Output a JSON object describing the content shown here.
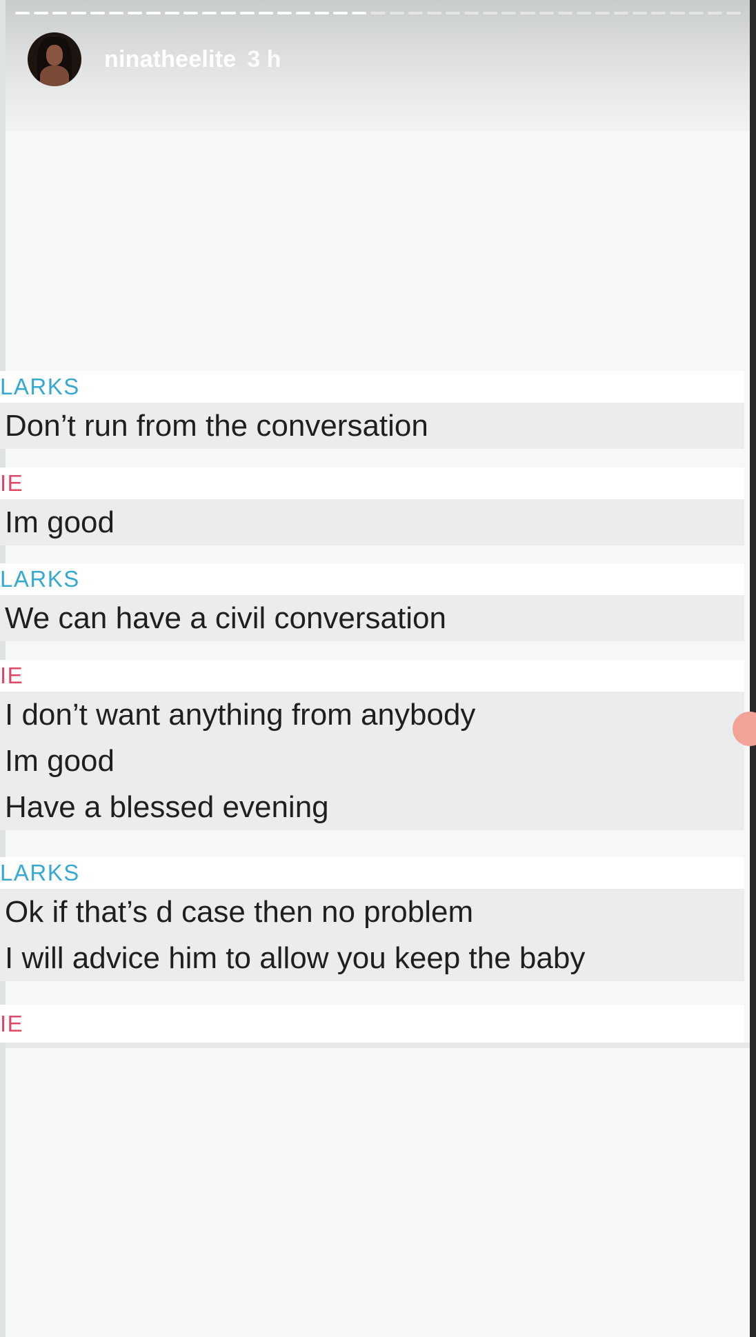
{
  "story": {
    "username": "ninatheelite",
    "time_ago": "3 h",
    "progress_segments_done": 19,
    "progress_segments_total": 39
  },
  "chat": {
    "blocks": [
      {
        "sender": "LARKS",
        "sender_color": "#36a9d2",
        "messages": [
          "Don’t run from the conversation"
        ]
      },
      {
        "sender": "IE",
        "sender_color": "#e04663",
        "messages": [
          "Im good"
        ]
      },
      {
        "sender": "LARKS",
        "sender_color": "#36a9d2",
        "messages": [
          "We can have a civil conversation"
        ]
      },
      {
        "sender": "IE",
        "sender_color": "#e04663",
        "messages": [
          "I don’t want anything from anybody",
          "Im good",
          "Have a blessed evening"
        ]
      },
      {
        "sender": "LARKS",
        "sender_color": "#36a9d2",
        "messages": [
          "Ok if that’s d case then no problem",
          "I will advice him to allow you keep the baby"
        ]
      },
      {
        "sender": "IE",
        "sender_color": "#e04663",
        "messages": []
      }
    ]
  },
  "colors": {
    "background": "#f6f7f7",
    "sender_blue": "#36a9d2",
    "sender_red": "#e04663",
    "message_bg": "#ebecee"
  }
}
